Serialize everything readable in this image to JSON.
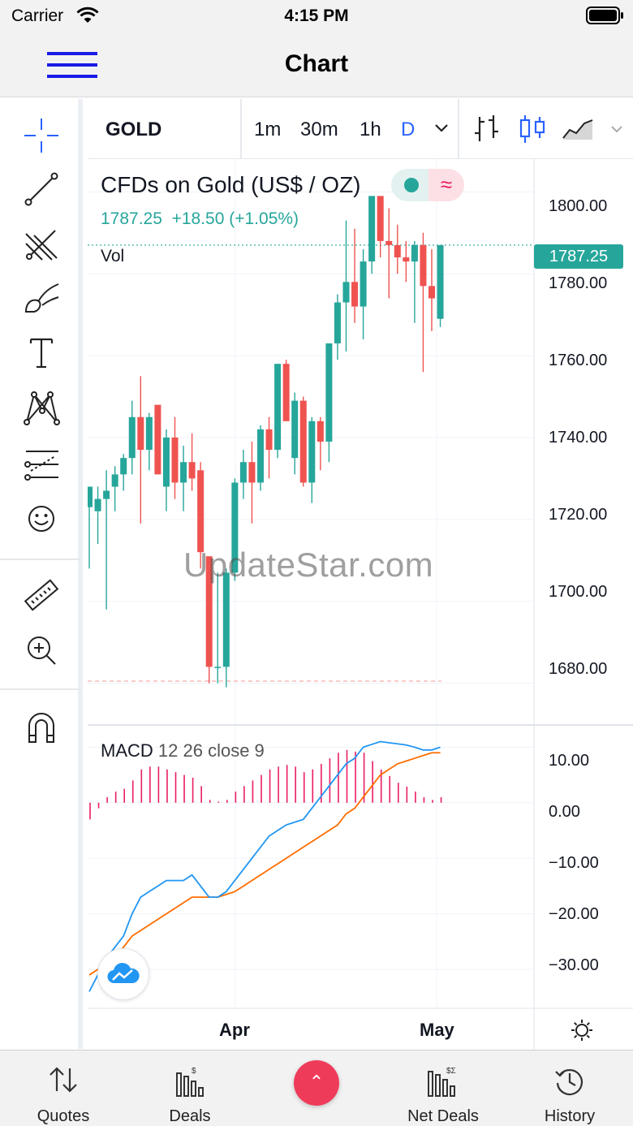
{
  "status_bar": {
    "carrier": "Carrier",
    "time": "4:15 PM"
  },
  "nav": {
    "title": "Chart",
    "menu_icon": "hamburger-icon"
  },
  "left_toolbar": {
    "tools": [
      "crosshair-icon",
      "trend-line-icon",
      "pitchfork-icon",
      "brush-icon",
      "text-icon",
      "pattern-icon",
      "prediction-icon",
      "emoji-icon",
      "ruler-icon",
      "zoom-icon",
      "magnet-icon"
    ]
  },
  "top_bar": {
    "symbol": "GOLD",
    "intervals": [
      "1m",
      "30m",
      "1h",
      "D"
    ],
    "active_interval": "D",
    "chart_type_icons": [
      "bars-icon",
      "candles-icon",
      "area-icon"
    ]
  },
  "legend": {
    "title": "CFDs on Gold (US$ / OZ)",
    "last": "1787.25",
    "change": "+18.50 (+1.05%)",
    "volume_label": "Vol",
    "wave_symbol": "≈"
  },
  "watermark": "UpdateStar.com",
  "macd": {
    "name": "MACD",
    "params": "12 26 close 9"
  },
  "price_axis": [
    "1800.00",
    "1780.00",
    "1760.00",
    "1740.00",
    "1720.00",
    "1700.00",
    "1680.00"
  ],
  "price_tag": "1787.25",
  "macd_axis": [
    "10.00",
    "0.00",
    "−10.00",
    "−20.00",
    "−30.00"
  ],
  "time_axis": [
    "Apr",
    "May"
  ],
  "colors": {
    "up": "#26a69a",
    "down": "#ef5350",
    "macd": "#2196f3",
    "signal": "#ff6d00",
    "hist": "#e91e63",
    "accent": "#2962ff"
  },
  "chart_data": {
    "type": "candlestick",
    "series": [
      {
        "name": "GOLD",
        "ohlc": [
          [
            1723,
            1728,
            1708,
            1728
          ],
          [
            1722,
            1728,
            1714,
            1725
          ],
          [
            1725,
            1732,
            1698,
            1727
          ],
          [
            1728,
            1733,
            1722,
            1731
          ],
          [
            1731,
            1736,
            1727,
            1735
          ],
          [
            1735,
            1749,
            1731,
            1745
          ],
          [
            1745,
            1755,
            1719,
            1737
          ],
          [
            1737,
            1746,
            1732,
            1745
          ],
          [
            1748,
            1740,
            1731,
            1731
          ],
          [
            1728,
            1742,
            1722,
            1740
          ],
          [
            1740,
            1745,
            1725,
            1729
          ],
          [
            1729,
            1738,
            1722,
            1734
          ],
          [
            1734,
            1741,
            1727,
            1730
          ],
          [
            1732,
            1734,
            1708,
            1712
          ],
          [
            1711,
            1710,
            1680,
            1684
          ],
          [
            1684,
            1707,
            1680,
            1684
          ],
          [
            1684,
            1708,
            1679,
            1707
          ],
          [
            1707,
            1730,
            1705,
            1729
          ],
          [
            1729,
            1737,
            1725,
            1734
          ],
          [
            1734,
            1739,
            1719,
            1729
          ],
          [
            1729,
            1743,
            1727,
            1742
          ],
          [
            1742,
            1745,
            1730,
            1737
          ],
          [
            1737,
            1756,
            1735,
            1758
          ],
          [
            1758,
            1759,
            1744,
            1744
          ],
          [
            1735,
            1751,
            1731,
            1749
          ],
          [
            1749,
            1750,
            1728,
            1729
          ],
          [
            1729,
            1745,
            1724,
            1744
          ],
          [
            1744,
            1745,
            1732,
            1739
          ],
          [
            1739,
            1762,
            1734,
            1763
          ],
          [
            1763,
            1775,
            1759,
            1773
          ],
          [
            1773,
            1793,
            1761,
            1778
          ],
          [
            1778,
            1791,
            1768,
            1772
          ],
          [
            1772,
            1786,
            1764,
            1783
          ],
          [
            1783,
            1797,
            1780,
            1799
          ],
          [
            1799,
            1797,
            1784,
            1788
          ],
          [
            1788,
            1796,
            1774,
            1787
          ],
          [
            1787,
            1792,
            1780,
            1784
          ],
          [
            1784,
            1788,
            1778,
            1783
          ],
          [
            1783,
            1788,
            1768,
            1787
          ],
          [
            1787,
            1790,
            1756,
            1777
          ],
          [
            1777,
            1786,
            1766,
            1774
          ],
          [
            1769,
            1787,
            1767,
            1787
          ]
        ]
      },
      {
        "name": "MACD",
        "values": [
          -34,
          -31,
          -28,
          -26,
          -24,
          -20,
          -17,
          -16,
          -15,
          -14,
          -14,
          -14,
          -13,
          -15,
          -17,
          -17,
          -16,
          -14,
          -12,
          -10,
          -8,
          -6,
          -5,
          -4,
          -3.5,
          -3,
          -1,
          1,
          3,
          5,
          7,
          8,
          10,
          10.5,
          11,
          10.8,
          10.6,
          10.4,
          10,
          9.5,
          9.5,
          10
        ]
      },
      {
        "name": "Signal",
        "values": [
          -31,
          -30,
          -29,
          -28,
          -26,
          -24,
          -23,
          -22,
          -21,
          -20,
          -19,
          -18,
          -17,
          -17,
          -17,
          -17,
          -16.5,
          -16,
          -15,
          -14,
          -13,
          -12,
          -11,
          -10,
          -9,
          -8,
          -7,
          -6,
          -5,
          -4,
          -2,
          -1,
          1,
          3,
          5,
          6,
          7,
          7.5,
          8,
          8.5,
          9,
          9
        ]
      },
      {
        "name": "Histogram",
        "values": [
          -3,
          -1,
          1,
          2,
          2.5,
          4,
          6,
          6.5,
          6.5,
          6,
          5.5,
          5,
          4.5,
          3,
          0.5,
          0.2,
          0.5,
          2,
          3,
          4,
          5,
          6,
          6.5,
          6.8,
          6.5,
          5.5,
          6,
          7,
          8,
          9,
          9.5,
          9.2,
          9,
          7.5,
          6,
          4.8,
          3.6,
          2.9,
          2,
          1,
          0.5,
          1
        ]
      }
    ],
    "ylim": [
      1670,
      1808
    ],
    "macd_ylim": [
      -37,
      14
    ],
    "x_ticks": [
      "Apr",
      "May"
    ],
    "grid": true
  },
  "tabs": [
    {
      "label": "Quotes",
      "icon": "quotes-icon"
    },
    {
      "label": "Deals",
      "icon": "deals-icon"
    },
    {
      "label": "",
      "icon": "chevron-up-icon"
    },
    {
      "label": "Net Deals",
      "icon": "net-deals-icon"
    },
    {
      "label": "History",
      "icon": "history-icon"
    }
  ]
}
